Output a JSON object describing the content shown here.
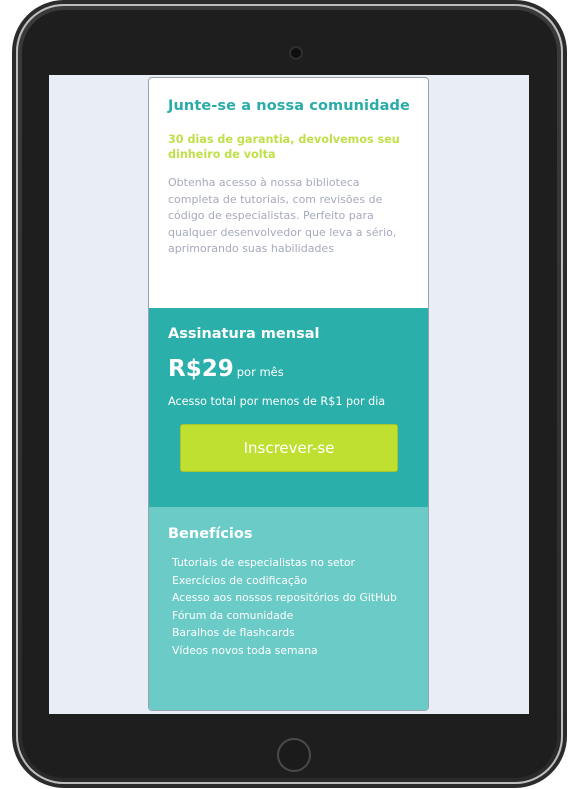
{
  "intro": {
    "title": "Junte-se a nossa comunidade",
    "guarantee": "30 dias de garantia, devolvemos seu dinheiro de volta",
    "description": "Obtenha acesso à nossa biblioteca completa de tutoriais, com revisões de código de especialistas. Perfeito para qualquer desenvolvedor que leva a sério, aprimorando suas habilidades"
  },
  "monthly": {
    "title": "Assinatura mensal",
    "price": "R$29",
    "period": "por mês",
    "access": "Acesso total por menos de R$1 por dia",
    "button_label": "Inscrever-se"
  },
  "benefits": {
    "title": "Benefícios",
    "items": [
      "Tutoriais de especialistas no setor",
      "Exercícios de codificação",
      "Acesso aos nossos repositórios do GitHub",
      "Fórum da comunidade",
      "Baralhos de flashcards",
      "Vídeos novos toda semana"
    ]
  },
  "colors": {
    "accent_teal": "#2aafaa",
    "light_teal": "#6bcbc7",
    "lime": "#bfe030",
    "screen_bg": "#e9eef6"
  }
}
